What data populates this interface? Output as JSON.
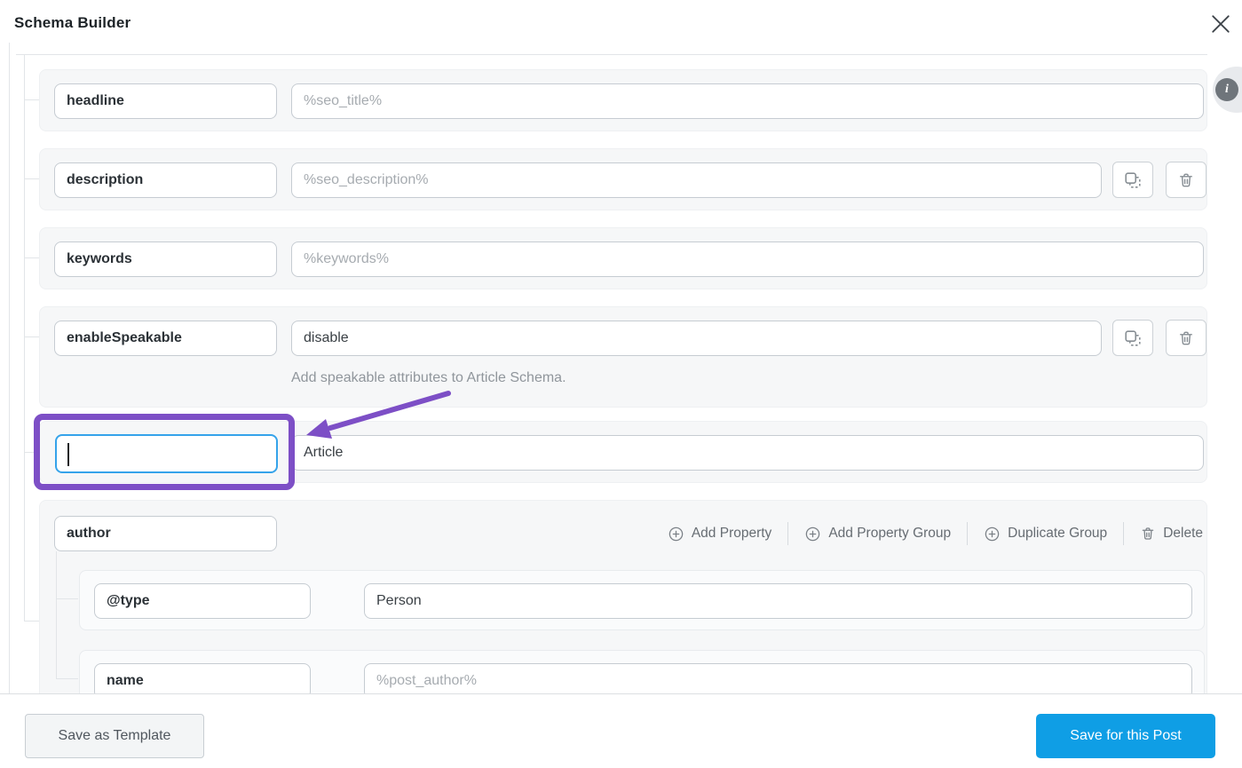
{
  "header": {
    "title": "Schema Builder",
    "close_icon": "x-icon"
  },
  "info_bubble": {
    "label": "i"
  },
  "properties": [
    {
      "key": "headline",
      "placeholder": "%seo_title%"
    },
    {
      "key": "description",
      "placeholder": "%seo_description%"
    },
    {
      "key": "keywords",
      "placeholder": "%keywords%"
    },
    {
      "key": "enableSpeakable",
      "value": "disable",
      "help": "Add speakable attributes to Article Schema."
    },
    {
      "key": "",
      "value": "Article"
    }
  ],
  "group": {
    "key": "author",
    "actions": {
      "add_property": "Add Property",
      "add_property_group": "Add Property Group",
      "duplicate_group": "Duplicate Group",
      "delete": "Delete"
    },
    "children": [
      {
        "key": "@type",
        "value": "Person"
      },
      {
        "key": "name",
        "placeholder": "%post_author%"
      }
    ]
  },
  "footer": {
    "save_template": "Save as Template",
    "save_post": "Save for this Post"
  },
  "icons": [
    "close-icon",
    "info-icon",
    "copy-icon",
    "trash-icon",
    "plus-circle-icon",
    "arrow-annotation"
  ],
  "colors": {
    "accent_purple": "#7d4fc6",
    "focus_blue": "#35a3ea",
    "primary_button_blue": "#0f9ee5",
    "row_background": "#f6f7f8"
  }
}
